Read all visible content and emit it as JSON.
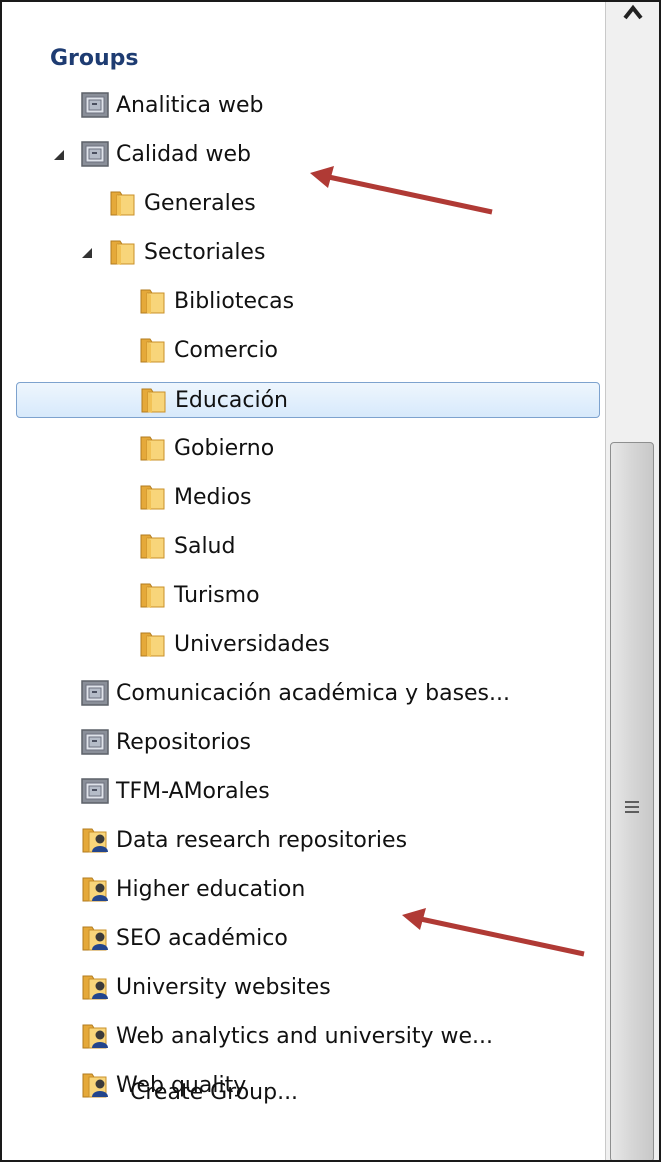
{
  "panel": {
    "heading": "Groups",
    "create_group": "Create Group..."
  },
  "tree": [
    {
      "label": "Analitica web",
      "icon": "group-box-icon",
      "level": 0,
      "expanded": null,
      "selected": false
    },
    {
      "label": "Calidad web",
      "icon": "group-box-icon",
      "level": 0,
      "expanded": true,
      "selected": false
    },
    {
      "label": "Generales",
      "icon": "folder-icon",
      "level": 1,
      "expanded": null,
      "selected": false
    },
    {
      "label": "Sectoriales",
      "icon": "folder-icon",
      "level": 1,
      "expanded": true,
      "selected": false
    },
    {
      "label": "Bibliotecas",
      "icon": "folder-icon",
      "level": 2,
      "expanded": null,
      "selected": false
    },
    {
      "label": "Comercio",
      "icon": "folder-icon",
      "level": 2,
      "expanded": null,
      "selected": false
    },
    {
      "label": "Educación",
      "icon": "folder-icon",
      "level": 2,
      "expanded": null,
      "selected": true
    },
    {
      "label": "Gobierno",
      "icon": "folder-icon",
      "level": 2,
      "expanded": null,
      "selected": false
    },
    {
      "label": "Medios",
      "icon": "folder-icon",
      "level": 2,
      "expanded": null,
      "selected": false
    },
    {
      "label": "Salud",
      "icon": "folder-icon",
      "level": 2,
      "expanded": null,
      "selected": false
    },
    {
      "label": "Turismo",
      "icon": "folder-icon",
      "level": 2,
      "expanded": null,
      "selected": false
    },
    {
      "label": "Universidades",
      "icon": "folder-icon",
      "level": 2,
      "expanded": null,
      "selected": false
    },
    {
      "label": "Comunicación académica y bases...",
      "icon": "group-box-icon",
      "level": 0,
      "expanded": null,
      "selected": false
    },
    {
      "label": "Repositorios",
      "icon": "group-box-icon",
      "level": 0,
      "expanded": null,
      "selected": false
    },
    {
      "label": "TFM-AMorales",
      "icon": "group-box-icon",
      "level": 0,
      "expanded": null,
      "selected": false
    },
    {
      "label": "Data research repositories",
      "icon": "shared-folder-icon",
      "level": 0,
      "expanded": null,
      "selected": false
    },
    {
      "label": "Higher education",
      "icon": "shared-folder-icon",
      "level": 0,
      "expanded": null,
      "selected": false
    },
    {
      "label": "SEO académico",
      "icon": "shared-folder-icon",
      "level": 0,
      "expanded": null,
      "selected": false
    },
    {
      "label": "University websites",
      "icon": "shared-folder-icon",
      "level": 0,
      "expanded": null,
      "selected": false
    },
    {
      "label": "Web analytics and university we...",
      "icon": "shared-folder-icon",
      "level": 0,
      "expanded": null,
      "selected": false
    },
    {
      "label": "Web quality",
      "icon": "shared-folder-icon",
      "level": 0,
      "expanded": null,
      "selected": false
    }
  ],
  "colors": {
    "heading": "#1e3c72",
    "selection_border": "#7da2ce",
    "annotation_arrow": "#b03a35"
  }
}
